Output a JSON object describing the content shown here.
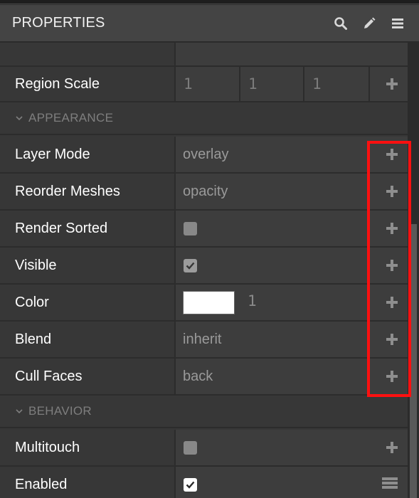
{
  "header": {
    "title": "PROPERTIES",
    "icons": [
      "search-icon",
      "pencil-icon",
      "menu-icon"
    ]
  },
  "rows": {
    "region_scale": {
      "label": "Region Scale",
      "values": [
        "1",
        "1",
        "1"
      ]
    },
    "appearance": {
      "label": "APPEARANCE"
    },
    "layer_mode": {
      "label": "Layer Mode",
      "value": "overlay"
    },
    "reorder_meshes": {
      "label": "Reorder Meshes",
      "value": "opacity"
    },
    "render_sorted": {
      "label": "Render Sorted",
      "checked": false
    },
    "visible": {
      "label": "Visible",
      "checked": true
    },
    "color": {
      "label": "Color",
      "swatch": "#ffffff",
      "alpha": "1"
    },
    "blend": {
      "label": "Blend",
      "value": "inherit"
    },
    "cull_faces": {
      "label": "Cull Faces",
      "value": "back"
    },
    "behavior": {
      "label": "BEHAVIOR"
    },
    "multitouch": {
      "label": "Multitouch",
      "checked": false
    },
    "enabled": {
      "label": "Enabled",
      "checked": true
    }
  },
  "colors": {
    "highlight": "#ff1010",
    "header_bg": "#444444",
    "panel_bg": "#373737"
  }
}
